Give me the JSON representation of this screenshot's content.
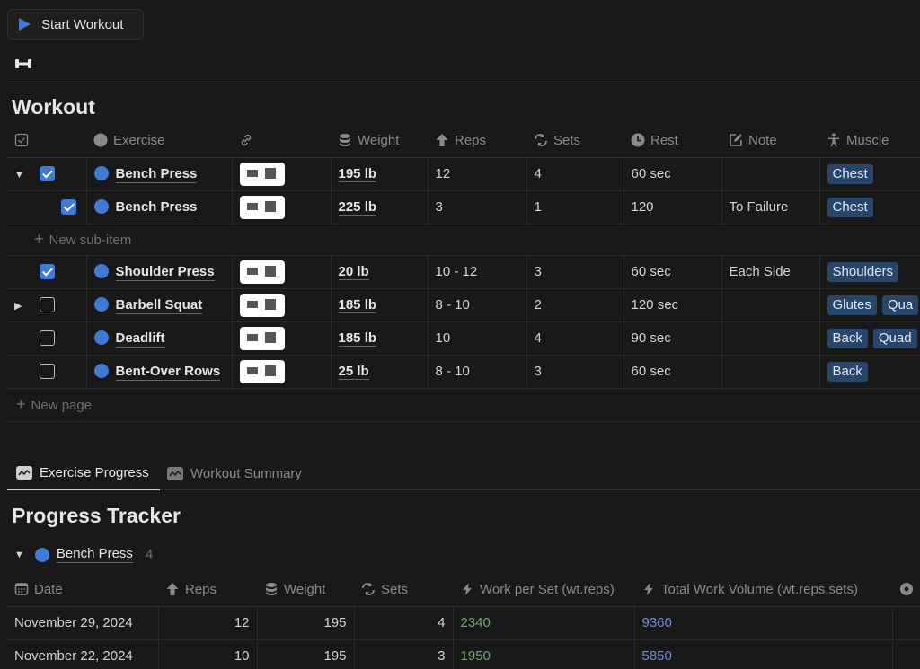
{
  "toolbar": {
    "start_label": "Start Workout"
  },
  "workout": {
    "title": "Workout",
    "columns": [
      "",
      "Exercise",
      "",
      "Weight",
      "Reps",
      "Sets",
      "Rest",
      "Note",
      "Muscle"
    ],
    "rows": [
      {
        "expander": "down",
        "checked": true,
        "indent": false,
        "exercise": "Bench Press",
        "weight": "195 lb",
        "reps": "12",
        "sets": "4",
        "rest": "60 sec",
        "note": "",
        "muscles": [
          "Chest"
        ]
      },
      {
        "expander": "",
        "checked": true,
        "indent": true,
        "exercise": "Bench Press",
        "weight": "225 lb",
        "reps": "3",
        "sets": "1",
        "rest": "120",
        "note": "To Failure",
        "muscles": [
          "Chest"
        ]
      },
      {
        "expander": "",
        "checked": true,
        "indent": false,
        "exercise": "Shoulder Press",
        "weight": "20 lb",
        "reps": "10 - 12",
        "sets": "3",
        "rest": "60 sec",
        "note": "Each Side",
        "muscles": [
          "Shoulders"
        ]
      },
      {
        "expander": "right",
        "checked": false,
        "indent": false,
        "exercise": "Barbell Squat",
        "weight": "185 lb",
        "reps": "8 - 10",
        "sets": "2",
        "rest": "120 sec",
        "note": "",
        "muscles": [
          "Glutes",
          "Qua"
        ]
      },
      {
        "expander": "",
        "checked": false,
        "indent": false,
        "exercise": "Deadlift",
        "weight": "185 lb",
        "reps": "10",
        "sets": "4",
        "rest": "90 sec",
        "note": "",
        "muscles": [
          "Back",
          "Quad"
        ]
      },
      {
        "expander": "",
        "checked": false,
        "indent": false,
        "exercise": "Bent-Over Rows",
        "weight": "25 lb",
        "reps": "8 - 10",
        "sets": "3",
        "rest": "60 sec",
        "note": "",
        "muscles": [
          "Back"
        ]
      }
    ],
    "new_sub_item": "New sub-item",
    "new_page": "New page"
  },
  "tabs": [
    {
      "label": "Exercise Progress",
      "active": true
    },
    {
      "label": "Workout Summary",
      "active": false
    }
  ],
  "progress": {
    "title": "Progress Tracker",
    "group": {
      "name": "Bench Press",
      "count": "4"
    },
    "columns": [
      "Date",
      "Reps",
      "Weight",
      "Sets",
      "Work per Set (wt.reps)",
      "Total Work Volume (wt.reps.sets)"
    ],
    "rows": [
      {
        "date": "November 29, 2024",
        "reps": "12",
        "weight": "195",
        "sets": "4",
        "work": "2340",
        "total": "9360"
      },
      {
        "date": "November 22, 2024",
        "reps": "10",
        "weight": "195",
        "sets": "3",
        "work": "1950",
        "total": "5850"
      }
    ]
  },
  "colors": {
    "accent": "#3f7ad6",
    "tag_bg": "#28456c",
    "work_green": "#6aa86d",
    "total_blue": "#6f8ed6"
  }
}
